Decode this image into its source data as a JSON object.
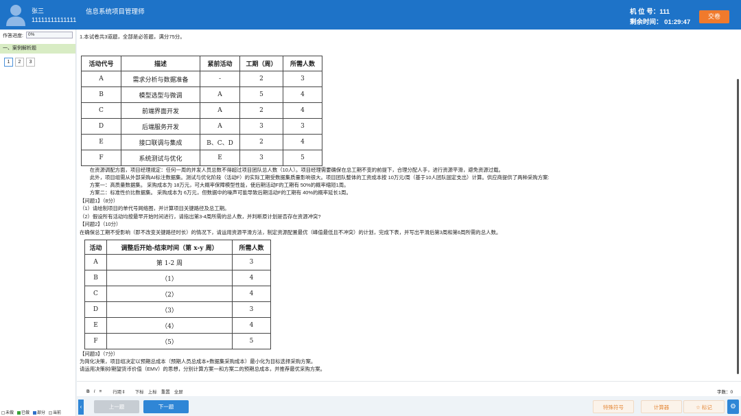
{
  "header": {
    "user_name": "张三",
    "user_id": "11111111111111",
    "exam_title": "信息系统项目管理师",
    "seat_label": "机 位 号：111",
    "timer_label": "剩余时间：",
    "timer_value": "01:29:47",
    "submit_label": "交卷",
    "avatar_icon": "user-avatar-icon"
  },
  "sidebar": {
    "progress_label": "作答进度:",
    "progress_value": "0%",
    "section_title": "一、案例解析题",
    "questions": [
      "1",
      "2",
      "3"
    ],
    "legend": [
      {
        "label": "未做",
        "color": "#ffffff"
      },
      {
        "label": "已做",
        "color": "#3aa33a"
      },
      {
        "label": "部分",
        "color": "#2f6fc9"
      },
      {
        "label": "当前",
        "color": "#e6e6e6"
      }
    ]
  },
  "main": {
    "intro": "1.本试卷共3道题，全部是必答题，满分75分。",
    "table1": {
      "headers": [
        "活动代号",
        "描述",
        "紧前活动",
        "工期（周）",
        "所需人数"
      ],
      "rows": [
        [
          "A",
          "需求分析与数据准备",
          "-",
          "2",
          "3"
        ],
        [
          "B",
          "模型选型与微调",
          "A",
          "5",
          "4"
        ],
        [
          "C",
          "前端界面开发",
          "A",
          "2",
          "4"
        ],
        [
          "D",
          "后端服务开发",
          "A",
          "3",
          "3"
        ],
        [
          "E",
          "接口联调与集成",
          "B、C、D",
          "2",
          "4"
        ],
        [
          "F",
          "系统测试与优化",
          "E",
          "3",
          "5"
        ]
      ]
    },
    "paragraphs": [
      "　　在资源调配方面，项目经理规定：任何一周的并发人员总数不得超过项目团队总人数（10人）。项目经理需要确保在总工期不变的前提下，合理分配人手，进行资源平滑，避免资源过载。",
      "　　此外，项目组需从外部采购AI标注数据集。测试与优化阶段（活动F）的实际工期受数据集质量影响很大。项目团队整体的工资成本按 10万元/周（基于10人团队固定支出）计算。供应商提供了两种采购方案:",
      "　　方案一：高质量数据集。 采购成本为 18万元，可大概率保障模型性能，使后期活动F的工期有 50%的概率缩短1周。",
      "　　方案二：标准性价比数据集。 采购成本为 6万元，但数据中的噪声可能导致后期活动F的工期有 40%的概率延长1周。",
      "【问题1】（8分）",
      "（1）请绘制项目的单代号网络图，并计算项目关键路径及总工期。",
      "（2）假设所有活动均按最早开始时间进行，请指出第3-4周所需的总人数，并判断原计划是否存在资源冲突?",
      "【问题2】（10分）",
      "在确保总工期不受影响（即不改变关键路径时长）的情况下，请运用资源平滑方法，制定资源配置最优（峰值最低且不冲突）的计划，完成下表，并写出平滑后第3周和第6周所需的总人数。"
    ],
    "table2": {
      "headers": [
        "活动",
        "调整后开始-结束时间（第 x-y 周）",
        "所需人数"
      ],
      "rows": [
        [
          "A",
          "第 1-2 周",
          "3"
        ],
        [
          "B",
          "（1）",
          "4"
        ],
        [
          "C",
          "（2）",
          "4"
        ],
        [
          "D",
          "（3）",
          "3"
        ],
        [
          "E",
          "（4）",
          "4"
        ],
        [
          "F",
          "（5）",
          "5"
        ]
      ]
    },
    "paragraphs2": [
      "【问题3】（7分）",
      "为简化决策，项目组决定以预期总成本（预期人员总成本+数据集采购成本）最小化为目标选择采购方案。",
      "请运用决策树/期望货币价值（EMV）的思想，分别计算方案一和方案二的预期总成本，并推荐最优采购方案。"
    ]
  },
  "editor": {
    "tools": [
      "B",
      "I",
      "≡",
      "行距",
      "下标",
      "上标",
      "重置",
      "全屏"
    ],
    "word_count": "字数：0"
  },
  "footer": {
    "prev_label": "上一题",
    "next_label": "下一题",
    "special_label": "特殊符号",
    "calc_label": "计算器",
    "mark_label": "标记",
    "settings_icon": "gear-icon",
    "collapse_icon": "chevron-left-icon"
  }
}
